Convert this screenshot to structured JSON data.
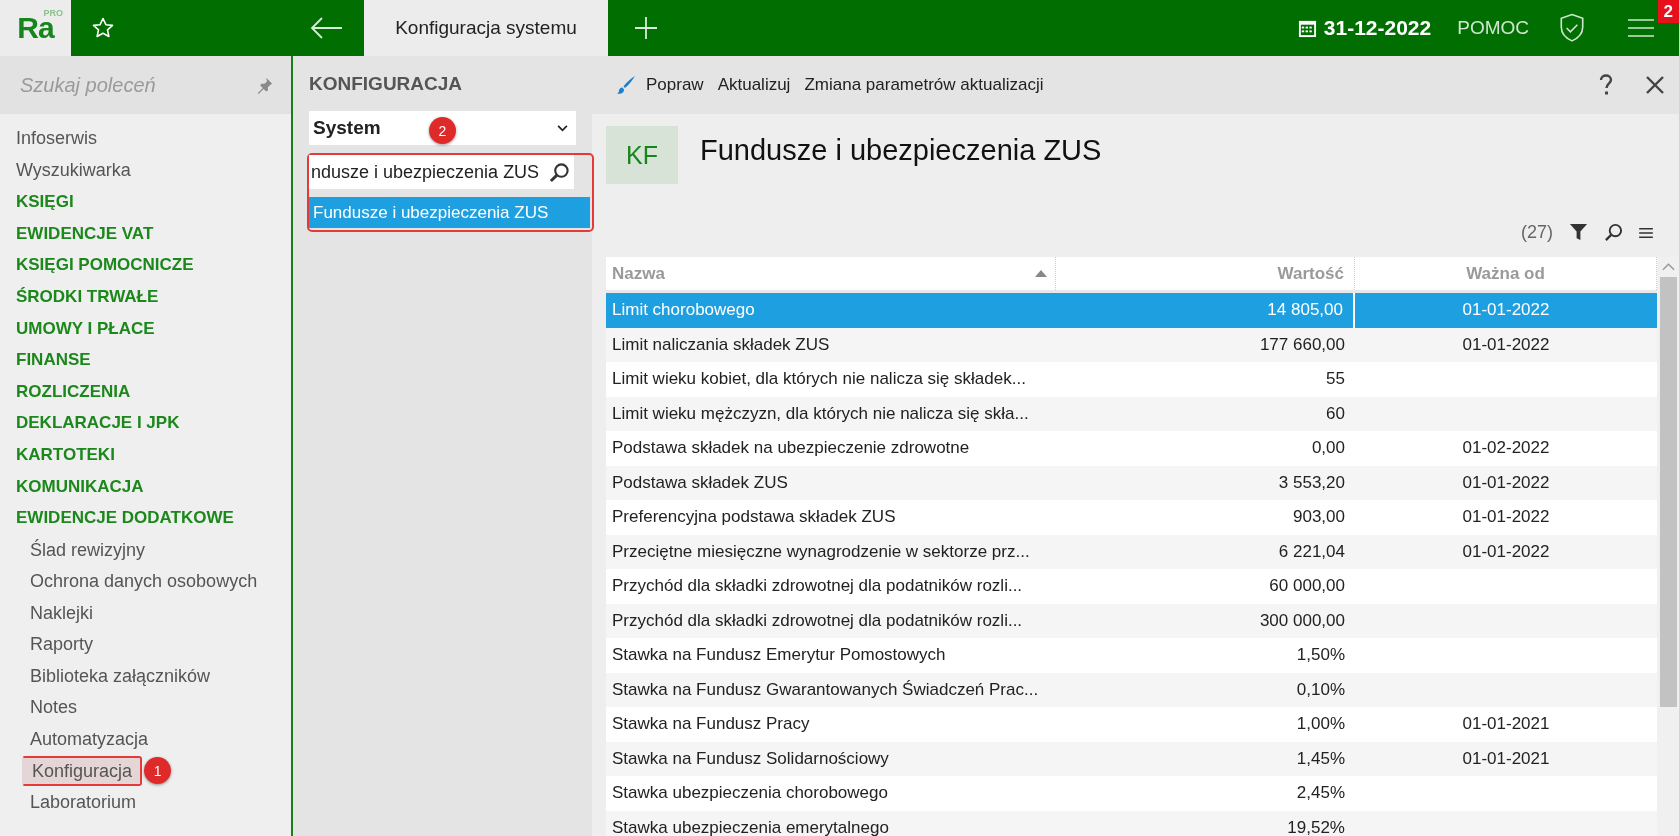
{
  "app_bar": {
    "logo": "Ra",
    "logo_badge": "PRO",
    "tabs": [
      {
        "label": "Konfiguracja systemu",
        "selected": true
      }
    ],
    "date": "31-12-2022",
    "help": "POMOC",
    "notification_count": "2"
  },
  "sidebar": {
    "search_placeholder": "Szukaj poleceń",
    "items": [
      {
        "label": "Infoserwis",
        "kind": "link"
      },
      {
        "label": "Wyszukiwarka",
        "kind": "link"
      },
      {
        "label": "KSIĘGI",
        "kind": "section"
      },
      {
        "label": "EWIDENCJE VAT",
        "kind": "section"
      },
      {
        "label": "KSIĘGI POMOCNICZE",
        "kind": "section"
      },
      {
        "label": "ŚRODKI TRWAŁE",
        "kind": "section"
      },
      {
        "label": "UMOWY I PŁACE",
        "kind": "section"
      },
      {
        "label": "FINANSE",
        "kind": "section"
      },
      {
        "label": "ROZLICZENIA",
        "kind": "section"
      },
      {
        "label": "DEKLARACJE I JPK",
        "kind": "section"
      },
      {
        "label": "KARTOTEKI",
        "kind": "section"
      },
      {
        "label": "KOMUNIKACJA",
        "kind": "section"
      },
      {
        "label": "EWIDENCJE DODATKOWE",
        "kind": "section",
        "children": [
          {
            "label": "Ślad rewizyjny",
            "selected": false
          },
          {
            "label": "Ochrona danych osobowych",
            "selected": false
          },
          {
            "label": "Naklejki",
            "selected": false
          },
          {
            "label": "Raporty",
            "selected": false
          },
          {
            "label": "Biblioteka załączników",
            "selected": false
          },
          {
            "label": "Notes",
            "selected": false
          },
          {
            "label": "Automatyzacja",
            "selected": false
          },
          {
            "label": "Konfiguracja",
            "selected": true,
            "callout": "1"
          },
          {
            "label": "Laboratorium",
            "selected": false
          }
        ]
      }
    ]
  },
  "config_panel": {
    "title": "KONFIGURACJA",
    "select": {
      "value": "System"
    },
    "callout": "2",
    "search": {
      "value": "ndusze i ubezpieczenia ZUS"
    },
    "results": [
      {
        "label": "Fundusze i ubezpieczenia ZUS",
        "selected": true
      }
    ]
  },
  "content": {
    "toolbar": [
      {
        "label": "Popraw",
        "kind": "brush"
      },
      {
        "label": "Aktualizuj",
        "kind": "plain"
      },
      {
        "label": "Zmiana parametrów aktualizacji",
        "kind": "plain"
      }
    ],
    "header": {
      "badge": "KF",
      "title": "Fundusze i ubezpieczenia ZUS"
    },
    "record_count": "(27)",
    "table": {
      "columns": [
        {
          "label": "Nazwa",
          "sorted": true
        },
        {
          "label": "Wartość"
        },
        {
          "label": "Ważna od"
        }
      ],
      "rows": [
        {
          "name": "Limit chorobowego",
          "value": "14 805,00",
          "valid_from": "01-01-2022",
          "selected": true
        },
        {
          "name": "Limit naliczania składek ZUS",
          "value": "177 660,00",
          "valid_from": "01-01-2022",
          "selected": false
        },
        {
          "name": "Limit wieku kobiet, dla których nie nalicza się składek...",
          "value": "55",
          "selected": false
        },
        {
          "name": "Limit wieku mężczyzn, dla których nie nalicza się skła...",
          "value": "60",
          "selected": false
        },
        {
          "name": "Podstawa składek na ubezpieczenie zdrowotne",
          "value": "0,00",
          "valid_from": "01-02-2022",
          "selected": false
        },
        {
          "name": "Podstawa składek ZUS",
          "value": "3 553,20",
          "valid_from": "01-01-2022",
          "selected": false
        },
        {
          "name": "Preferencyjna podstawa składek ZUS",
          "value": "903,00",
          "valid_from": "01-01-2022",
          "selected": false
        },
        {
          "name": "Przeciętne miesięczne wynagrodzenie w sektorze prz...",
          "value": "6 221,04",
          "valid_from": "01-01-2022",
          "selected": false
        },
        {
          "name": "Przychód dla składki zdrowotnej dla podatników rozli...",
          "value": "60 000,00",
          "selected": false
        },
        {
          "name": "Przychód dla składki zdrowotnej dla podatników rozli...",
          "value": "300 000,00",
          "selected": false
        },
        {
          "name": "Stawka na Fundusz Emerytur Pomostowych",
          "value": "1,50%",
          "selected": false
        },
        {
          "name": "Stawka na Fundusz Gwarantowanych Świadczeń Prac...",
          "value": "0,10%",
          "selected": false
        },
        {
          "name": "Stawka na Fundusz Pracy",
          "value": "1,00%",
          "valid_from": "01-01-2021",
          "selected": false
        },
        {
          "name": "Stawka na Fundusz Solidarnościowy",
          "value": "1,45%",
          "valid_from": "01-01-2021",
          "selected": false
        },
        {
          "name": "Stawka ubezpieczenia chorobowego",
          "value": "2,45%",
          "selected": false
        },
        {
          "name": "Stawka ubezpieczenia emerytalnego",
          "value": "19,52%",
          "selected": false
        }
      ]
    }
  }
}
